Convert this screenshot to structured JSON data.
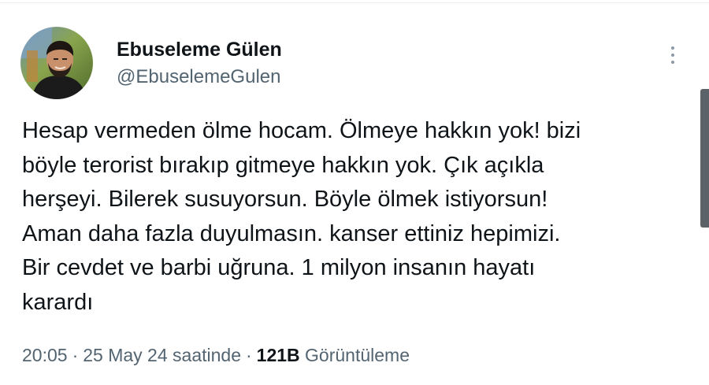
{
  "author": {
    "display_name": "Ebuseleme Gülen",
    "handle": "@EbuselemeGulen",
    "avatar_icon": "profile-photo"
  },
  "tweet": {
    "text": "Hesap vermeden ölme hocam. Ölmeye hakkın yok! bizi\nböyle terorist bırakıp gitmeye hakkın yok. Çık açıkla\nherşeyi. Bilerek susuyorsun. Böyle ölmek istiyorsun!\nAman daha fazla duyulmasın. kanser ettiniz hepimizi.\nBir cevdet ve barbi uğruna. 1 milyon insanın hayatı\nkarardı"
  },
  "meta": {
    "time": "20:05",
    "separator": "·",
    "date": "25 May 24 saatinde",
    "views_count": "121B",
    "views_label": "Görüntüleme"
  },
  "colors": {
    "text_primary": "#0f1419",
    "text_secondary": "#536471",
    "more_dots": "#8b98a5",
    "scrollbar": "#5b6368"
  }
}
